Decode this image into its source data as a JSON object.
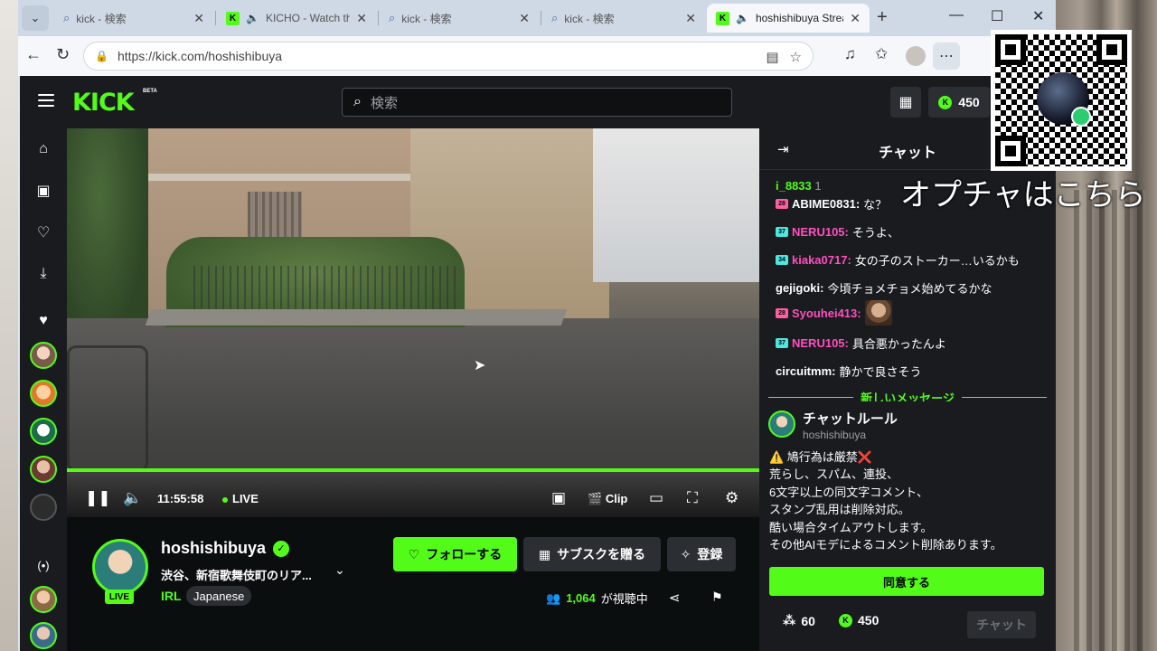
{
  "browser": {
    "tabs": [
      {
        "title": "kick - 検索",
        "icon": "search-icon",
        "active": false
      },
      {
        "title": "KICHO - Watch the V",
        "icon": "kick-favicon",
        "audio": true,
        "active": false
      },
      {
        "title": "kick - 検索",
        "icon": "search-icon",
        "active": false
      },
      {
        "title": "kick - 検索",
        "icon": "search-icon",
        "active": false
      },
      {
        "title": "hoshishibuya Stream",
        "icon": "kick-favicon",
        "audio": true,
        "active": true
      }
    ],
    "url": "https://kick.com/hoshishibuya"
  },
  "header": {
    "logo": "KICK",
    "beta": "BETA",
    "search_placeholder": "検索",
    "kicks_balance": "450"
  },
  "player": {
    "time": "11:55:58",
    "live_label": "LIVE",
    "clip_label": "Clip",
    "progress": 1.0
  },
  "stream": {
    "streamer": "hoshishibuya",
    "live_badge": "LIVE",
    "title": "渋谷、新宿歌舞伎町のリア...",
    "category": "IRL",
    "tag": "Japanese",
    "follow_label": "フォローする",
    "gift_sub_label": "サブスクを贈る",
    "subscribe_label": "登録",
    "viewer_count": "1,064",
    "viewer_suffix": "が視聴中"
  },
  "chat": {
    "title": "チャット",
    "pinned": {
      "user": "i_8833",
      "extra": "1"
    },
    "messages": [
      {
        "badge": "28",
        "badge_color": "#ff5fa2",
        "user": "ABIME0831",
        "user_color": "#ffffff",
        "text": "な？"
      },
      {
        "badge": "37",
        "badge_color": "#4ee6e0",
        "user": "NERU105",
        "user_color": "#ff4fbf",
        "text": "そうよ、"
      },
      {
        "badge": "34",
        "badge_color": "#4ee6e0",
        "user": "kiaka0717",
        "user_color": "#ff4fbf",
        "text": "女の子のストーカー…いるかも"
      },
      {
        "badge": "",
        "badge_color": "",
        "user": "gejigoki",
        "user_color": "#ffffff",
        "text": "今頃チョメチョメ始めてるかな"
      },
      {
        "badge": "28",
        "badge_color": "#ff5fa2",
        "user": "Syouhei413",
        "user_color": "#ff4fbf",
        "text": ""
      },
      {
        "badge": "37",
        "badge_color": "#4ee6e0",
        "user": "NERU105",
        "user_color": "#ff4fbf",
        "text": "具合悪かったんよ"
      },
      {
        "badge": "",
        "badge_color": "",
        "user": "circuitmm",
        "user_color": "#ffffff",
        "text": "静かで良さそう"
      }
    ],
    "new_messages_label": "新しいメッセージ",
    "rules": {
      "title": "チャットルール",
      "author": "hoshishibuya",
      "body": "⚠️ 鳩行為は厳禁❌\n荒らし、スパム、連投、\n6文字以上の同文字コメント、\nスタンプ乱用は削除対応。\n酷い場合タイムアウトします。\nその他AIモデによるコメント削除あります。",
      "agree_label": "同意する"
    },
    "footer": {
      "points": "60",
      "kicks": "450",
      "send_label": "チャット"
    }
  },
  "overlay": {
    "caption": "オプチャはこちら"
  },
  "colors": {
    "accent": "#53fc18",
    "bg": "#0b0e0f",
    "panel": "#191b1f"
  }
}
